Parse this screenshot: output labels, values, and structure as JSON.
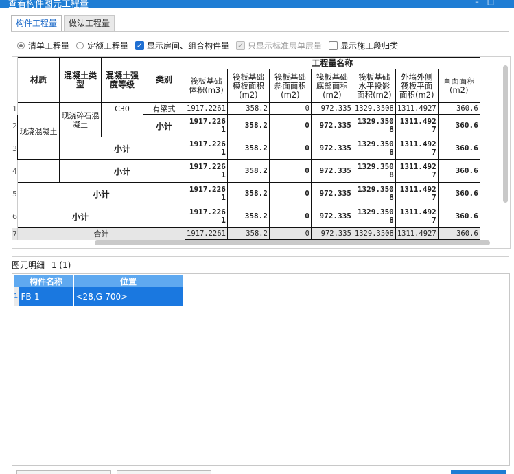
{
  "window": {
    "title": "查看构件图元工程量",
    "minimize": "–",
    "maximize": "□"
  },
  "tabs": [
    {
      "label": "构件工程量",
      "active": true
    },
    {
      "label": "做法工程量",
      "active": false
    }
  ],
  "options": {
    "qd": "清单工程量",
    "de": "定额工程量",
    "show_room": "显示房间、组合构件量",
    "std_floor": "只显示标准层单层量",
    "stage": "显示施工段归类"
  },
  "grid": {
    "headers": {
      "material": "材质",
      "concrete_type": "混凝土类型",
      "concrete_grade": "混凝土强度等级",
      "category": "类别",
      "qty_name": "工程量名称",
      "cols": [
        "筏板基础体积(m3)",
        "筏板基础模板面积(m2)",
        "筏板基础斜面面积(m2)",
        "筏板基础底部面积(m2)",
        "筏板基础水平投影面积(m2)",
        "外墙外侧筏板平面面积(m2)",
        "直面面积(m2)"
      ]
    },
    "rownums": [
      "1",
      "2",
      "3",
      "4",
      "5",
      "6",
      "7"
    ],
    "material": "现浇混凝土",
    "concrete_type": "现浇碎石混凝土",
    "grade": "C30",
    "with_beam": "有梁式",
    "subtotal": "小计",
    "total": "合计",
    "values": [
      "1917.2261",
      "358.2",
      "0",
      "972.335",
      "1329.3508",
      "1311.4927",
      "360.6"
    ]
  },
  "detail": {
    "label": "图元明细",
    "count": "1 (1)",
    "columns": [
      "构件名称",
      "位置"
    ],
    "rownum": "1",
    "row": {
      "name": "FB-1",
      "position": "<28,G-700>"
    }
  }
}
